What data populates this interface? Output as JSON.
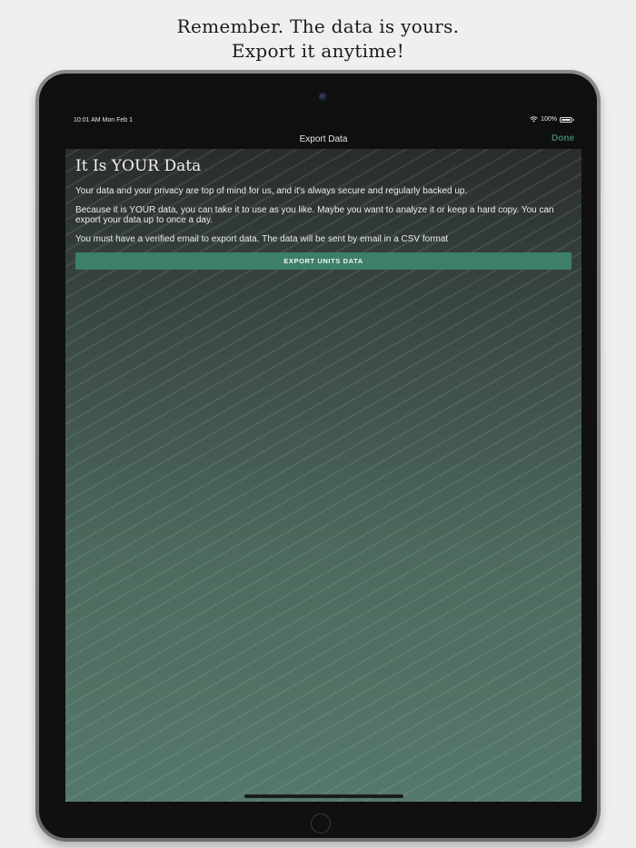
{
  "headline": {
    "line1": "Remember. The data is yours.",
    "line2": "Export it anytime!"
  },
  "status_bar": {
    "time": "10:01 AM  Mon Feb 1",
    "battery": "100%"
  },
  "nav": {
    "title": "Export Data",
    "done_label": "Done"
  },
  "content": {
    "title": "It Is YOUR Data",
    "paragraphs": [
      "Your data and your privacy are top of mind for us, and it's always secure and regularly backed up.",
      "Because it is YOUR data, you can take it to use as you like. Maybe you want to analyze it or keep a hard copy. You can export your data up to once a day.",
      "You must have a verified email to export data. The data will be sent by email in a CSV format"
    ],
    "export_button_label": "EXPORT UNITS DATA"
  },
  "colors": {
    "accent": "#3d7f67",
    "background_top": "#262626",
    "background_bottom": "#55786a"
  }
}
